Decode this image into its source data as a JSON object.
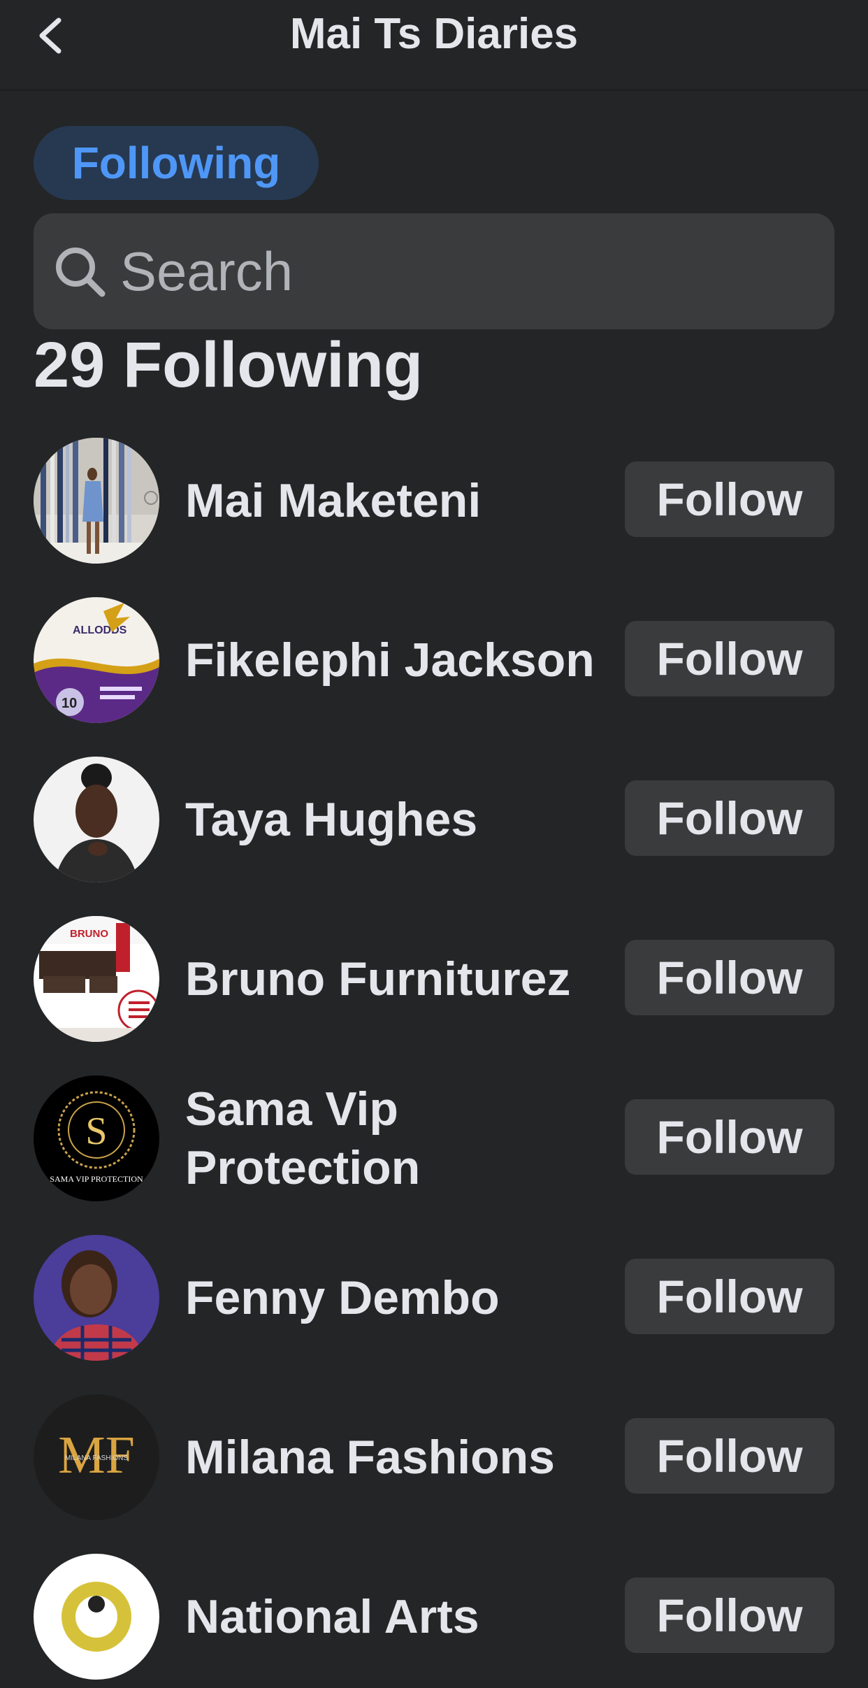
{
  "header": {
    "title": "Mai Ts Diaries",
    "back_icon": "chevron-left-icon"
  },
  "filter_chip": {
    "label": "Following",
    "color": "#4f97f7"
  },
  "search": {
    "placeholder": "Search",
    "value": "",
    "icon": "search-icon"
  },
  "following_count_label": "29 Following",
  "follow_button_label": "Follow",
  "people": [
    {
      "name": "Mai Maketeni",
      "follow_label": "Follow"
    },
    {
      "name": "Fikelephi Jackson",
      "follow_label": "Follow"
    },
    {
      "name": "Taya Hughes",
      "follow_label": "Follow"
    },
    {
      "name": "Bruno Furniturez",
      "follow_label": "Follow"
    },
    {
      "name": "Sama Vip Protection",
      "follow_label": "Follow"
    },
    {
      "name": "Fenny Dembo",
      "follow_label": "Follow"
    },
    {
      "name": "Milana Fashions",
      "follow_label": "Follow"
    },
    {
      "name": "National Arts",
      "follow_label": "Follow"
    }
  ],
  "avatar_logos": {
    "allodds": "ALLODDS",
    "bruno": "BRUNO",
    "sama_letter": "S",
    "sama_caption": "SAMA VIP PROTECTION",
    "milana_letters": "MF",
    "milana_caption": "MILANA FASHIONS"
  },
  "colors": {
    "background": "#242526",
    "surface": "#3a3b3c",
    "chip_bg": "#263951",
    "accent": "#4f97f7",
    "text": "#e4e6eb",
    "placeholder": "#b0b3b8"
  }
}
